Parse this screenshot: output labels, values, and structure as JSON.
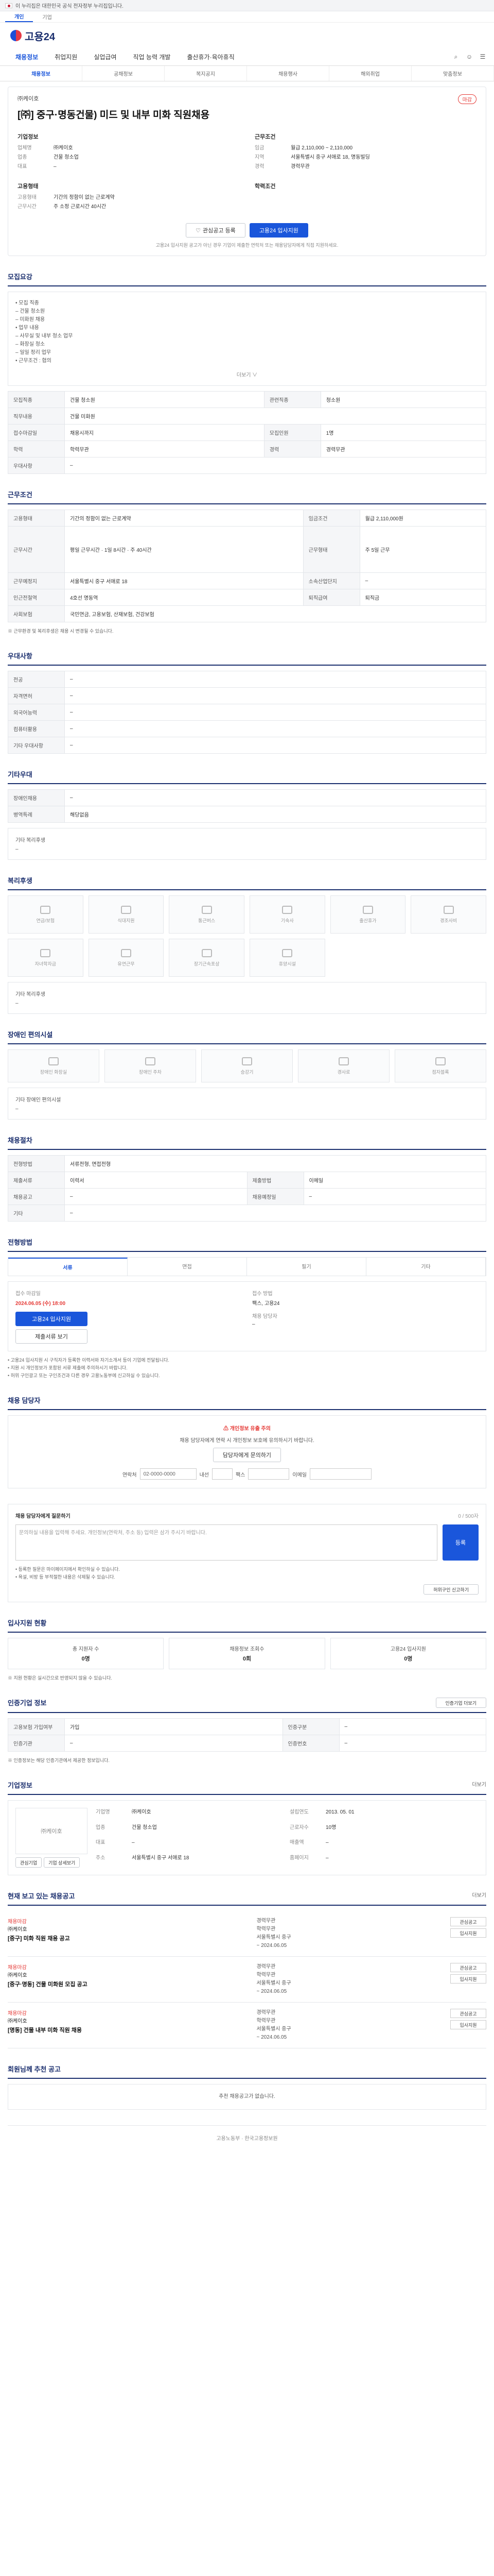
{
  "topbar": {
    "notice": "이 누리집은 대한민국 공식 전자정부 누리집입니다."
  },
  "sitebar": {
    "tabs": [
      "개인",
      "기업"
    ]
  },
  "logo": {
    "text": "고용24"
  },
  "nav": {
    "items": [
      "채용정보",
      "취업지원",
      "실업급여",
      "직업 능력 개발",
      "출산휴가·육아휴직"
    ],
    "icons": [
      "search-icon",
      "user-icon",
      "menu-icon"
    ]
  },
  "subnav": {
    "items": [
      "채용정보",
      "공채정보",
      "복지공지",
      "채용행사",
      "해외취업",
      "맞춤정보"
    ]
  },
  "job": {
    "company": "㈜케이호",
    "badge": "마감",
    "title": "[㈜] 중구·명동건물) 미드 및 내부 미화 직원채용",
    "left_header": "기업정보",
    "right_header": "근무조건",
    "company_rows": [
      {
        "k": "업체명",
        "v": "㈜케이호"
      },
      {
        "k": "업종",
        "v": "건물 청소업"
      },
      {
        "k": "대표",
        "v": "–"
      }
    ],
    "cond_rows": [
      {
        "k": "임금",
        "v": "월급 2,110,000 ~ 2,110,000"
      },
      {
        "k": "지역",
        "v": "서울특별시 중구 서애로 18, 명동빌딩"
      },
      {
        "k": "경력",
        "v": "경력무관"
      }
    ],
    "req_header": "고용형태",
    "req_rows": [
      {
        "k": "고용형태",
        "v": "기간의 정함이 없는 근로계약"
      },
      {
        "k": "근무시간",
        "v": "주 소정 근로시간 40시간"
      }
    ],
    "edu_header": "학력조건",
    "scrap_btn": "관심공고 등록",
    "apply_btn": "고용24 입사지원",
    "notice": "고용24 입사지원 공고가 아닌 경우 기업이 제출한 연락처 또는 채용담당자에게 직접 지원하세요."
  },
  "recruit_overview": {
    "title": "모집요강",
    "lines": [
      "• 모집 직종",
      "  – 건물 청소원",
      "  – 미화원 채용",
      "• 업무 내용",
      "  – 사무실 및 내부 청소 업무",
      "  – 화장실 청소",
      "  – 일일 정리 업무",
      "• 근무조건 : 협의"
    ],
    "more": "더보기 ∨"
  },
  "recruit_table": {
    "rows": [
      [
        {
          "k": "모집직종",
          "v": "건물 청소원"
        },
        {
          "k": "관련직종",
          "v": "청소원"
        }
      ],
      [
        {
          "k": "직무내용",
          "v": "건물 미화원"
        },
        {
          "k": "",
          "v": ""
        }
      ],
      [
        {
          "k": "접수마감일",
          "v": "채용시까지"
        },
        {
          "k": "모집인원",
          "v": "1명"
        }
      ],
      [
        {
          "k": "학력",
          "v": "학력무관"
        },
        {
          "k": "경력",
          "v": "경력무관"
        }
      ],
      [
        {
          "k": "우대사항",
          "v": "–"
        },
        {
          "k": "",
          "v": ""
        }
      ]
    ]
  },
  "work_table": {
    "title": "근무조건",
    "rows": [
      [
        {
          "k": "고용형태",
          "v": "기간의 정함이 없는 근로계약"
        },
        {
          "k": "임금조건",
          "v": "월급 2,110,000원"
        }
      ],
      [
        {
          "k": "근무시간",
          "v": "평일 근무시간 · 1일 8시간 · 주 40시간"
        },
        {
          "k": "근무형태",
          "v": "주 5일 근무"
        }
      ],
      [
        {
          "k": "근무예정지",
          "v": "서울특별시 중구 서애로 18"
        },
        {
          "k": "소속산업단지",
          "v": "–"
        }
      ],
      [
        {
          "k": "인근전철역",
          "v": "4호선 명동역"
        },
        {
          "k": "퇴직급여",
          "v": "퇴직금"
        }
      ],
      [
        {
          "k": "사회보험",
          "v": "국민연금, 고용보험, 산재보험, 건강보험"
        },
        {
          "k": "",
          "v": ""
        }
      ]
    ],
    "footnote": "※ 근무환경 및 복리후생은 채용 시 변경될 수 있습니다."
  },
  "preference": {
    "title": "우대사항",
    "rows": [
      {
        "k": "전공",
        "v": "–"
      },
      {
        "k": "자격면허",
        "v": "–"
      },
      {
        "k": "외국어능력",
        "v": "–"
      },
      {
        "k": "컴퓨터활용",
        "v": "–"
      },
      {
        "k": "기타 우대사항",
        "v": "–"
      }
    ]
  },
  "training": {
    "title": "기타우대",
    "rows": [
      {
        "k": "장애인채용",
        "v": "–"
      },
      {
        "k": "병역특례",
        "v": "해당없음"
      }
    ],
    "extra_title": "기타 복리후생",
    "extra_val": "–"
  },
  "welfare": {
    "title": "복리후생",
    "tiles": [
      "연금/보험",
      "식대지원",
      "통근버스",
      "기숙사",
      "출산휴가",
      "경조사비",
      "자녀학자금",
      "유연근무",
      "장기근속포상",
      "휴양시설"
    ],
    "extra_title": "기타 복리후생",
    "extra_val": "–"
  },
  "disability": {
    "title": "장애인 편의시설",
    "tiles": [
      "장애인 화장실",
      "장애인 주차",
      "승강기",
      "경사로",
      "점자블록"
    ],
    "extra_title": "기타 장애인 편의시설",
    "extra_val": "–"
  },
  "process": {
    "title": "채용절차",
    "rows": [
      [
        {
          "k": "전형방법",
          "v": "서류전형, 면접전형"
        },
        {
          "k": "",
          "v": ""
        }
      ],
      [
        {
          "k": "제출서류",
          "v": "이력서"
        },
        {
          "k": "제출방법",
          "v": "이메일"
        }
      ],
      [
        {
          "k": "채용공고",
          "v": "–"
        },
        {
          "k": "채용예정일",
          "v": "–"
        }
      ],
      [
        {
          "k": "기타",
          "v": "–"
        },
        {
          "k": "",
          "v": ""
        }
      ]
    ]
  },
  "apply_method": {
    "title": "전형방법",
    "tabs": [
      "서류",
      "면접",
      "필기",
      "기타"
    ],
    "deadline_lbl": "접수 마감일",
    "deadline_val": "2024.06.05 (수) 18:00",
    "method_lbl": "접수 방법",
    "method_val": "팩스, 고용24",
    "apply_btn": "고용24 입사지원",
    "docs_btn": "제출서류 보기",
    "contact_lbl": "채용 담당자",
    "contact_val": "–",
    "notices": [
      "• 고용24 입사지원 시 구직자가 등록한 이력서와 자기소개서 등이 기업에 전달됩니다.",
      "• 지원 시 개인정보가 포함된 서류 제출에 주의하시기 바랍니다.",
      "• 허위 구인광고 또는 구인조건과 다른 경우 고용노동부에 신고하실 수 있습니다."
    ]
  },
  "manager": {
    "title": "채용 담당자",
    "warn": "개인정보 유출 주의",
    "desc": "채용 담당자에게 연락 시 개인정보 보호에 유의하시기 바랍니다.",
    "btn": "담당자에게 문의하기",
    "phone_lbl": "연락처",
    "phone_val": "02-0000-0000",
    "ext_lbl": "내선",
    "fax_lbl": "팩스",
    "email_lbl": "이메일"
  },
  "qa": {
    "title": "채용 담당자에게 질문하기",
    "placeholder": "문의하실 내용을 입력해 주세요. 개인정보(연락처, 주소 등) 입력은 삼가 주시기 바랍니다.",
    "count": "0 / 500자",
    "btn": "등록",
    "notes": [
      "• 등록한 질문은 마이페이지에서 확인하실 수 있습니다.",
      "• 욕설, 비방 등 부적절한 내용은 삭제될 수 있습니다."
    ],
    "report_btn": "허위구인 신고하기"
  },
  "stats": {
    "title": "입사지원 현황",
    "items": [
      {
        "label": "총 지원자 수",
        "val": "0명"
      },
      {
        "label": "채용정보 조회수",
        "val": "0회"
      },
      {
        "label": "고용24 입사지원",
        "val": "0명"
      }
    ],
    "note": "※ 지원 현황은 실시간으로 반영되지 않을 수 있습니다."
  },
  "info": {
    "title": "인증기업 정보",
    "more_btn": "인증기업 더보기",
    "rows": [
      [
        {
          "k": "고용보험 가입여부",
          "v": "가입"
        },
        {
          "k": "인증구분",
          "v": "–"
        }
      ],
      [
        {
          "k": "인증기관",
          "v": "–"
        },
        {
          "k": "인증번호",
          "v": "–"
        }
      ]
    ],
    "note": "※ 인증정보는 해당 인증기관에서 제공한 정보입니다."
  },
  "company": {
    "title": "기업정보",
    "more": "더보기",
    "logo_text": "㈜케이호",
    "buttons": [
      "관심기업",
      "기업 상세보기"
    ],
    "fields": [
      {
        "k": "기업명",
        "v": "㈜케이호"
      },
      {
        "k": "설립연도",
        "v": "2013. 05. 01"
      },
      {
        "k": "업종",
        "v": "건물 청소업"
      },
      {
        "k": "근로자수",
        "v": "10명"
      },
      {
        "k": "대표",
        "v": "–"
      },
      {
        "k": "매출액",
        "v": "–"
      },
      {
        "k": "주소",
        "v": "서울특별시 중구 서애로 18"
      },
      {
        "k": "홈페이지",
        "v": "–"
      }
    ]
  },
  "similar": {
    "title": "현재 보고 있는 채용공고",
    "more": "더보기",
    "items": [
      {
        "tag": "채용마감",
        "company": "㈜케이호",
        "title": "[중구] 미화 직원 채용 공고",
        "date": "~ 2024.06.05",
        "lines": [
          "경력무관",
          "학력무관",
          "서울특별시 중구"
        ],
        "btns": [
          "관심공고",
          "입사지원"
        ]
      },
      {
        "tag": "채용마감",
        "company": "㈜케이호",
        "title": "[중구·명동] 건물 미화원 모집 공고",
        "date": "~ 2024.06.05",
        "lines": [
          "경력무관",
          "학력무관",
          "서울특별시 중구"
        ],
        "btns": [
          "관심공고",
          "입사지원"
        ]
      },
      {
        "tag": "채용마감",
        "company": "㈜케이호",
        "title": "[명동] 건물 내부 미화 직원 채용",
        "date": "~ 2024.06.05",
        "lines": [
          "경력무관",
          "학력무관",
          "서울특별시 중구"
        ],
        "btns": [
          "관심공고",
          "입사지원"
        ]
      }
    ]
  },
  "recommend": {
    "title": "회원님께 추천 공고",
    "note": "추천 채용공고가 없습니다."
  },
  "footer": {
    "text": "고용노동부 · 한국고용정보원"
  }
}
